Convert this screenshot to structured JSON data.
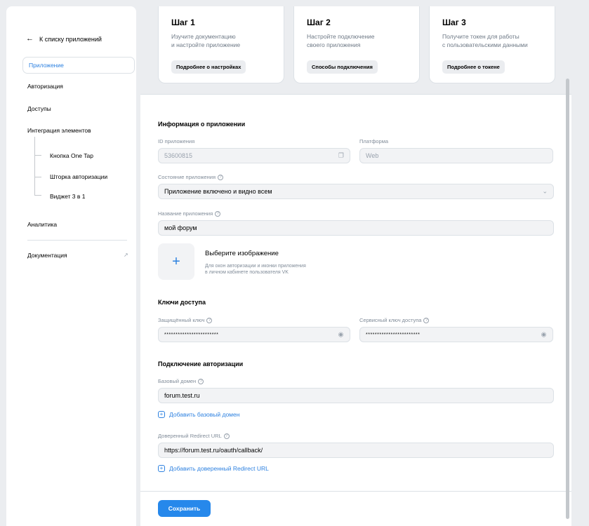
{
  "sidebar": {
    "back_label": "К списку приложений",
    "items": [
      {
        "label": "Приложение"
      },
      {
        "label": "Авторизация"
      },
      {
        "label": "Доступы"
      },
      {
        "label": "Интеграция элементов"
      },
      {
        "label": "Аналитика"
      },
      {
        "label": "Документация"
      }
    ],
    "sub_items": [
      {
        "label": "Кнопка One Tap"
      },
      {
        "label": "Шторка авторизации"
      },
      {
        "label": "Виджет 3 в 1"
      }
    ]
  },
  "steps": [
    {
      "title": "Шаг 1",
      "desc1": "Изучите документацию",
      "desc2": "и настройте приложение",
      "button": "Подробнее о настройках"
    },
    {
      "title": "Шаг 2",
      "desc1": "Настройте подключение",
      "desc2": "своего приложения",
      "button": "Способы подключения"
    },
    {
      "title": "Шаг 3",
      "desc1": "Получите токен для работы",
      "desc2": "с пользовательскими данными",
      "button": "Подробнее о токене"
    }
  ],
  "app_info": {
    "section_title": "Информация о приложении",
    "id_label": "ID приложения",
    "id_value": "53600815",
    "platform_label": "Платформа",
    "platform_value": "Web",
    "state_label": "Состояние приложения",
    "state_value": "Приложение включено и видно всем",
    "name_label": "Название приложения",
    "name_value": "мой форум",
    "image_title": "Выберите изображение",
    "image_desc1": "Для окон авторизации и иконки приложения",
    "image_desc2": "в личном кабинете пользователя VK"
  },
  "keys": {
    "section_title": "Ключи доступа",
    "secure_label": "Защищённый ключ",
    "secure_value": "************************",
    "service_label": "Сервисный ключ доступа",
    "service_value": "************************"
  },
  "auth": {
    "section_title": "Подключение авторизации",
    "domain_label": "Базовый домен",
    "domain_value": "forum.test.ru",
    "add_domain": "Добавить базовый домен",
    "redirect_label": "Доверенный Redirect URL",
    "redirect_value": "https://forum.test.ru/oauth/callback/",
    "add_redirect": "Добавить доверенный Redirect URL"
  },
  "save_label": "Сохранить",
  "accent_color": "#2688eb"
}
